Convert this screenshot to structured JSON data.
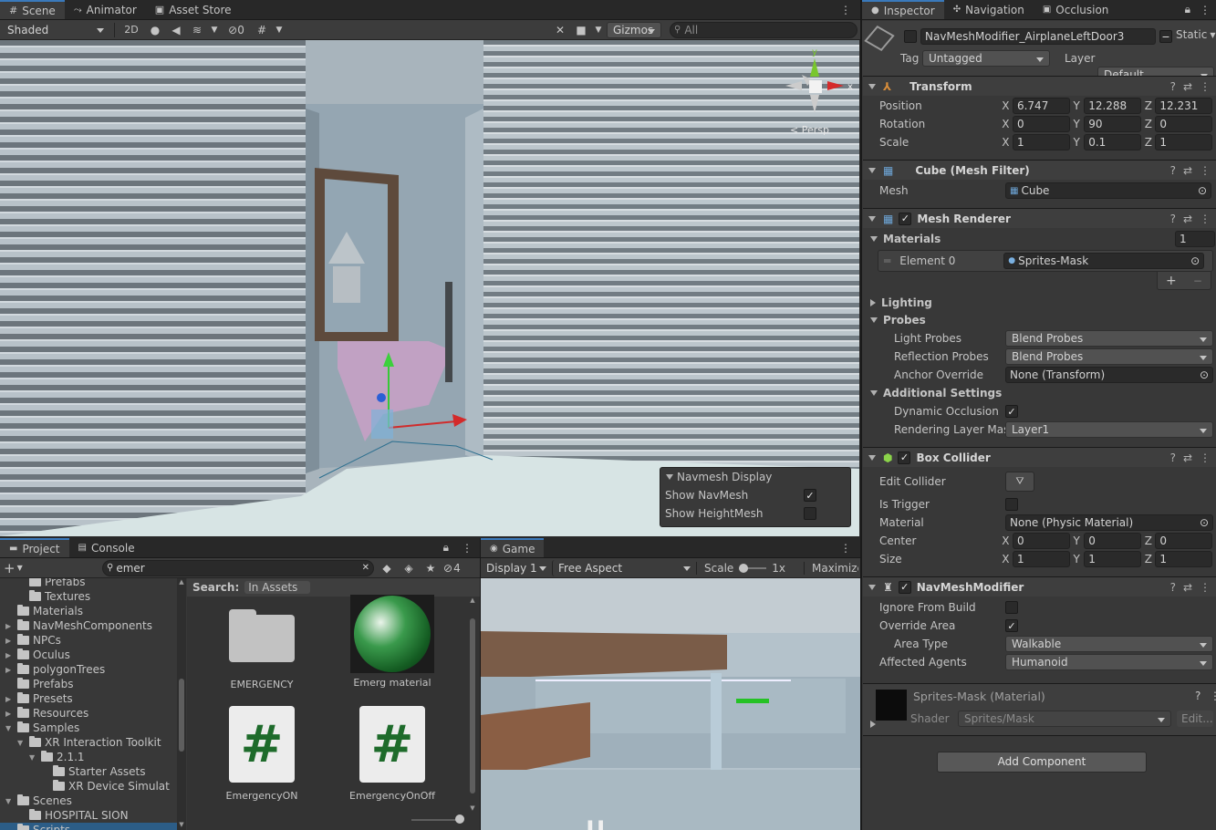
{
  "scene_panel": {
    "tabs": [
      "Scene",
      "Animator",
      "Asset Store"
    ],
    "shading_mode": "Shaded",
    "btn_2d": "2D",
    "hidden_count": "0",
    "gizmos_label": "Gizmos",
    "search_placeholder": "All",
    "persp_label": "< Persp",
    "navmesh_display": {
      "title": "Navmesh Display",
      "show_navmesh_label": "Show NavMesh",
      "show_navmesh_checked": true,
      "show_heightmesh_label": "Show HeightMesh",
      "show_heightmesh_checked": false
    }
  },
  "project_panel": {
    "tabs": [
      "Project",
      "Console"
    ],
    "search_value": "emer",
    "hidden_count": "4",
    "search_label": "Search:",
    "search_scope": "In Assets",
    "tree": [
      {
        "label": "Prefabs",
        "indent": 2
      },
      {
        "label": "Textures",
        "indent": 2
      },
      {
        "label": "Materials",
        "indent": 1
      },
      {
        "label": "NavMeshComponents",
        "indent": 1,
        "arrow": "right"
      },
      {
        "label": "NPCs",
        "indent": 1,
        "arrow": "right"
      },
      {
        "label": "Oculus",
        "indent": 1,
        "arrow": "right"
      },
      {
        "label": "polygonTrees",
        "indent": 1,
        "arrow": "right"
      },
      {
        "label": "Prefabs",
        "indent": 1
      },
      {
        "label": "Presets",
        "indent": 1,
        "arrow": "right"
      },
      {
        "label": "Resources",
        "indent": 1,
        "arrow": "right"
      },
      {
        "label": "Samples",
        "indent": 1,
        "arrow": "down"
      },
      {
        "label": "XR Interaction Toolkit",
        "indent": 2,
        "arrow": "down"
      },
      {
        "label": "2.1.1",
        "indent": 3,
        "arrow": "down"
      },
      {
        "label": "Starter Assets",
        "indent": 4
      },
      {
        "label": "XR Device Simulat",
        "indent": 4
      },
      {
        "label": "Scenes",
        "indent": 1,
        "arrow": "down"
      },
      {
        "label": "HOSPITAL SION",
        "indent": 2
      },
      {
        "label": "Scripts",
        "indent": 1
      }
    ],
    "assets": [
      {
        "label": "EMERGENCY",
        "kind": "folder"
      },
      {
        "label": "Emerg material",
        "kind": "material"
      },
      {
        "label": "EmergencyON",
        "kind": "script"
      },
      {
        "label": "EmergencyOnOff",
        "kind": "script"
      }
    ]
  },
  "game_panel": {
    "tab": "Game",
    "display": "Display 1",
    "aspect": "Free Aspect",
    "scale_label": "Scale",
    "scale_value": "1x",
    "maximize": "Maximize"
  },
  "inspector": {
    "tabs": [
      "Inspector",
      "Navigation",
      "Occlusion"
    ],
    "object_name": "NavMeshModifier_AirplaneLeftDoor3",
    "static_label": "Static",
    "tag_label": "Tag",
    "tag_value": "Untagged",
    "layer_label": "Layer",
    "layer_value": "Default",
    "transform": {
      "title": "Transform",
      "position": {
        "label": "Position",
        "x": "6.747",
        "y": "12.288",
        "z": "12.231"
      },
      "rotation": {
        "label": "Rotation",
        "x": "0",
        "y": "90",
        "z": "0"
      },
      "scale": {
        "label": "Scale",
        "x": "1",
        "y": "0.1",
        "z": "1"
      }
    },
    "mesh_filter": {
      "title": "Cube (Mesh Filter)",
      "mesh_label": "Mesh",
      "mesh_value": "Cube"
    },
    "mesh_renderer": {
      "title": "Mesh Renderer",
      "materials_label": "Materials",
      "materials_count": "1",
      "element_label": "Element 0",
      "element_value": "Sprites-Mask",
      "lighting_label": "Lighting",
      "probes_label": "Probes",
      "light_probes_label": "Light Probes",
      "light_probes_value": "Blend Probes",
      "reflection_probes_label": "Reflection Probes",
      "reflection_probes_value": "Blend Probes",
      "anchor_override_label": "Anchor Override",
      "anchor_override_value": "None (Transform)",
      "additional_settings_label": "Additional Settings",
      "dynamic_occlusion_label": "Dynamic Occlusion",
      "rendering_layer_label": "Rendering Layer Masl",
      "rendering_layer_value": "Layer1"
    },
    "box_collider": {
      "title": "Box Collider",
      "edit_collider_label": "Edit Collider",
      "is_trigger_label": "Is Trigger",
      "material_label": "Material",
      "material_value": "None (Physic Material)",
      "center": {
        "label": "Center",
        "x": "0",
        "y": "0",
        "z": "0"
      },
      "size": {
        "label": "Size",
        "x": "1",
        "y": "1",
        "z": "1"
      }
    },
    "navmesh_modifier": {
      "title": "NavMeshModifier",
      "ignore_label": "Ignore From Build",
      "override_label": "Override Area",
      "area_type_label": "Area Type",
      "area_type_value": "Walkable",
      "affected_label": "Affected Agents",
      "affected_value": "Humanoid"
    },
    "material_preview": {
      "title": "Sprites-Mask (Material)",
      "shader_label": "Shader",
      "shader_value": "Sprites/Mask",
      "edit_label": "Edit..."
    },
    "add_component": "Add Component"
  }
}
